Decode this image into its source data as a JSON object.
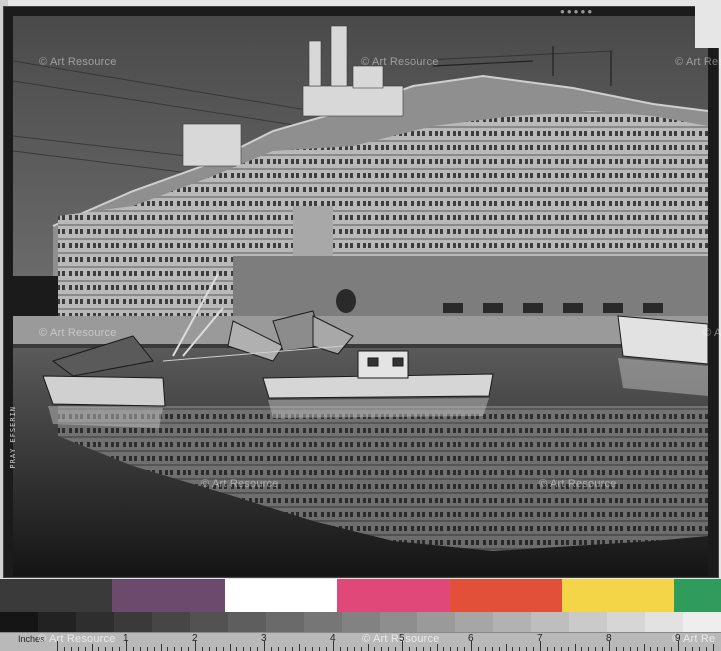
{
  "watermark": {
    "text": "© Art Resource",
    "clipped_right": "© Art R",
    "clipped_right_2": "© Art Re"
  },
  "side_label": "PRAY EFSERIN",
  "ruler": {
    "unit_label": "Inches",
    "numbers": [
      "1",
      "2",
      "3",
      "4",
      "5",
      "6",
      "7",
      "8",
      "9"
    ]
  },
  "colors": {
    "color_patches": [
      "#3a3a3a",
      "#6b4a6e",
      "#ffffff",
      "#e0487a",
      "#e2503a",
      "#f4d548",
      "#2f9c5c"
    ],
    "gray_steps": [
      "#151515",
      "#222222",
      "#2e2e2e",
      "#3a3a3a",
      "#464646",
      "#525252",
      "#5e5e5e",
      "#6a6a6a",
      "#767676",
      "#828282",
      "#8e8e8e",
      "#9a9a9a",
      "#a6a6a6",
      "#b2b2b2",
      "#bebebe",
      "#cacaca",
      "#d6d6d6",
      "#e2e2e2",
      "#eeeeee"
    ]
  }
}
